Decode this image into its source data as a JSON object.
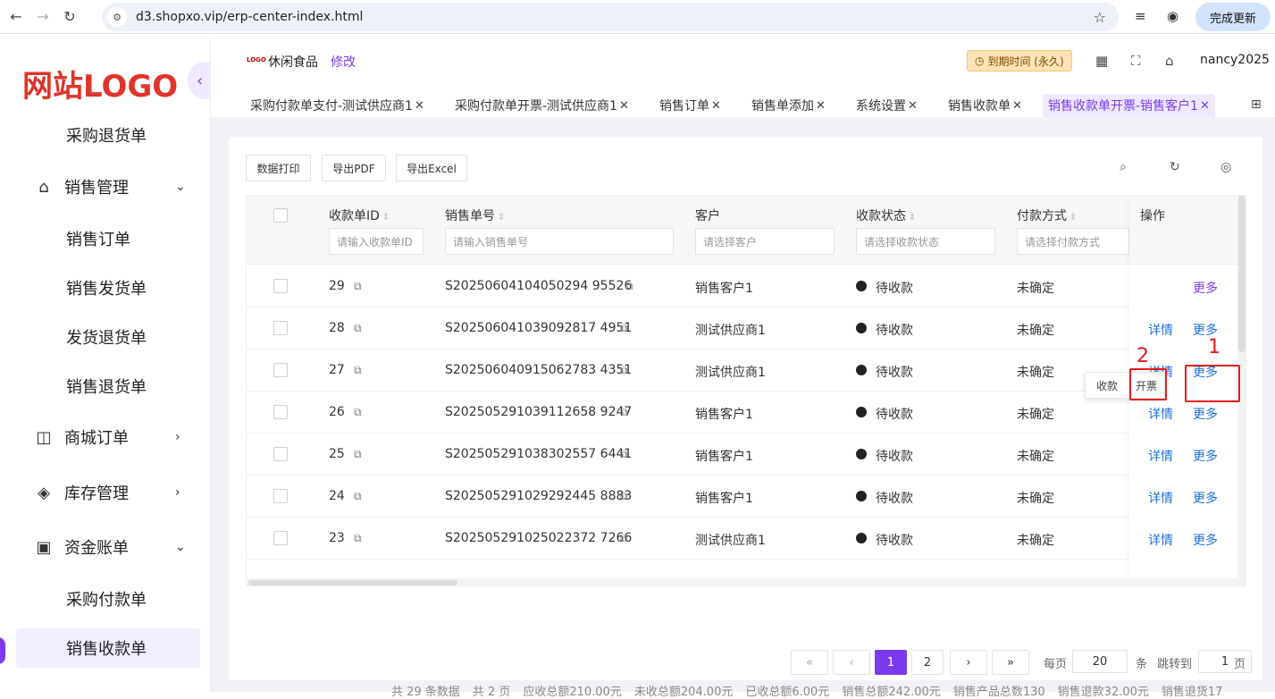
{
  "browser": {
    "url": "d3.shopxo.vip/erp-center-index.html",
    "update_button": "完成更新"
  },
  "sidebar": {
    "logo": "网站LOGO",
    "items": [
      {
        "label": "采购退货单",
        "kind": "sub"
      },
      {
        "label": "销售管理",
        "kind": "group",
        "icon": "tag-icon",
        "expanded": true
      },
      {
        "label": "销售订单",
        "kind": "sub"
      },
      {
        "label": "销售发货单",
        "kind": "sub"
      },
      {
        "label": "发货退货单",
        "kind": "sub"
      },
      {
        "label": "销售退货单",
        "kind": "sub"
      },
      {
        "label": "商城订单",
        "kind": "group",
        "icon": "shopping-bag-icon",
        "expanded": false
      },
      {
        "label": "库存管理",
        "kind": "group",
        "icon": "cube-icon",
        "expanded": false
      },
      {
        "label": "资金账单",
        "kind": "group",
        "icon": "wallet-icon",
        "expanded": true
      },
      {
        "label": "采购付款单",
        "kind": "sub"
      },
      {
        "label": "销售收款单",
        "kind": "sub",
        "active": true
      }
    ]
  },
  "header": {
    "shop_logo_text": "LOGO",
    "shop_name": "休闲食品",
    "edit_label": "修改",
    "expire_label": "到期时间 (永久)",
    "username": "nancy2025"
  },
  "tabs": [
    {
      "label": "采购付款单支付-测试供应商1"
    },
    {
      "label": "采购付款单开票-测试供应商1"
    },
    {
      "label": "销售订单"
    },
    {
      "label": "销售单添加"
    },
    {
      "label": "系统设置"
    },
    {
      "label": "销售收款单"
    },
    {
      "label": "销售收款单开票-销售客户1",
      "active": true
    }
  ],
  "toolbar": {
    "print": "数据打印",
    "pdf": "导出PDF",
    "excel": "导出Excel"
  },
  "table": {
    "columns": {
      "id": "收款单ID",
      "order": "销售单号",
      "customer": "客户",
      "status": "收款状态",
      "payment": "付款方式",
      "ops": "操作"
    },
    "filters": {
      "id": "请输入收款单ID",
      "order": "请输入销售单号",
      "customer": "请选择客户",
      "status": "请选择收款状态",
      "payment": "请选择付款方式"
    },
    "rows": [
      {
        "id": "29",
        "order": "S20250604104050294 95526",
        "customer": "销售客户1",
        "status": "待收款",
        "payment": "未确定"
      },
      {
        "id": "28",
        "order": "S202506041039092817 4951",
        "customer": "测试供应商1",
        "status": "待收款",
        "payment": "未确定"
      },
      {
        "id": "27",
        "order": "S202506040915062783 4351",
        "customer": "测试供应商1",
        "status": "待收款",
        "payment": "未确定"
      },
      {
        "id": "26",
        "order": "S202505291039112658 9247",
        "customer": "销售客户1",
        "status": "待收款",
        "payment": "未确定"
      },
      {
        "id": "25",
        "order": "S202505291038302557 6441",
        "customer": "销售客户1",
        "status": "待收款",
        "payment": "未确定"
      },
      {
        "id": "24",
        "order": "S202505291029292445 8883",
        "customer": "销售客户1",
        "status": "待收款",
        "payment": "未确定"
      },
      {
        "id": "23",
        "order": "S202505291025022372 7266",
        "customer": "测试供应商1",
        "status": "待收款",
        "payment": "未确定"
      }
    ],
    "detail_label": "详情",
    "more_label": "更多"
  },
  "popover": {
    "receive": "收款",
    "invoice": "开票"
  },
  "annotations": {
    "one": "1",
    "two": "2"
  },
  "pagination": {
    "prev_first": "«",
    "prev": "‹",
    "pages": [
      "1",
      "2"
    ],
    "next": "›",
    "last": "»",
    "per_page_label": "每页",
    "per_page": "20",
    "per_page_unit": "条",
    "jump_label": "跳转到",
    "jump_value": "1",
    "jump_unit": "页"
  },
  "summary": [
    "共 29 条数据",
    "共 2 页",
    "应收总额210.00元",
    "未收总额204.00元",
    "已收总额6.00元",
    "销售总额242.00元",
    "销售产品总数130",
    "销售退款32.00元",
    "销售退货17"
  ],
  "colors": {
    "accent": "#7c3aed",
    "link": "#1e6fd9",
    "annotation": "#e51c1c"
  }
}
